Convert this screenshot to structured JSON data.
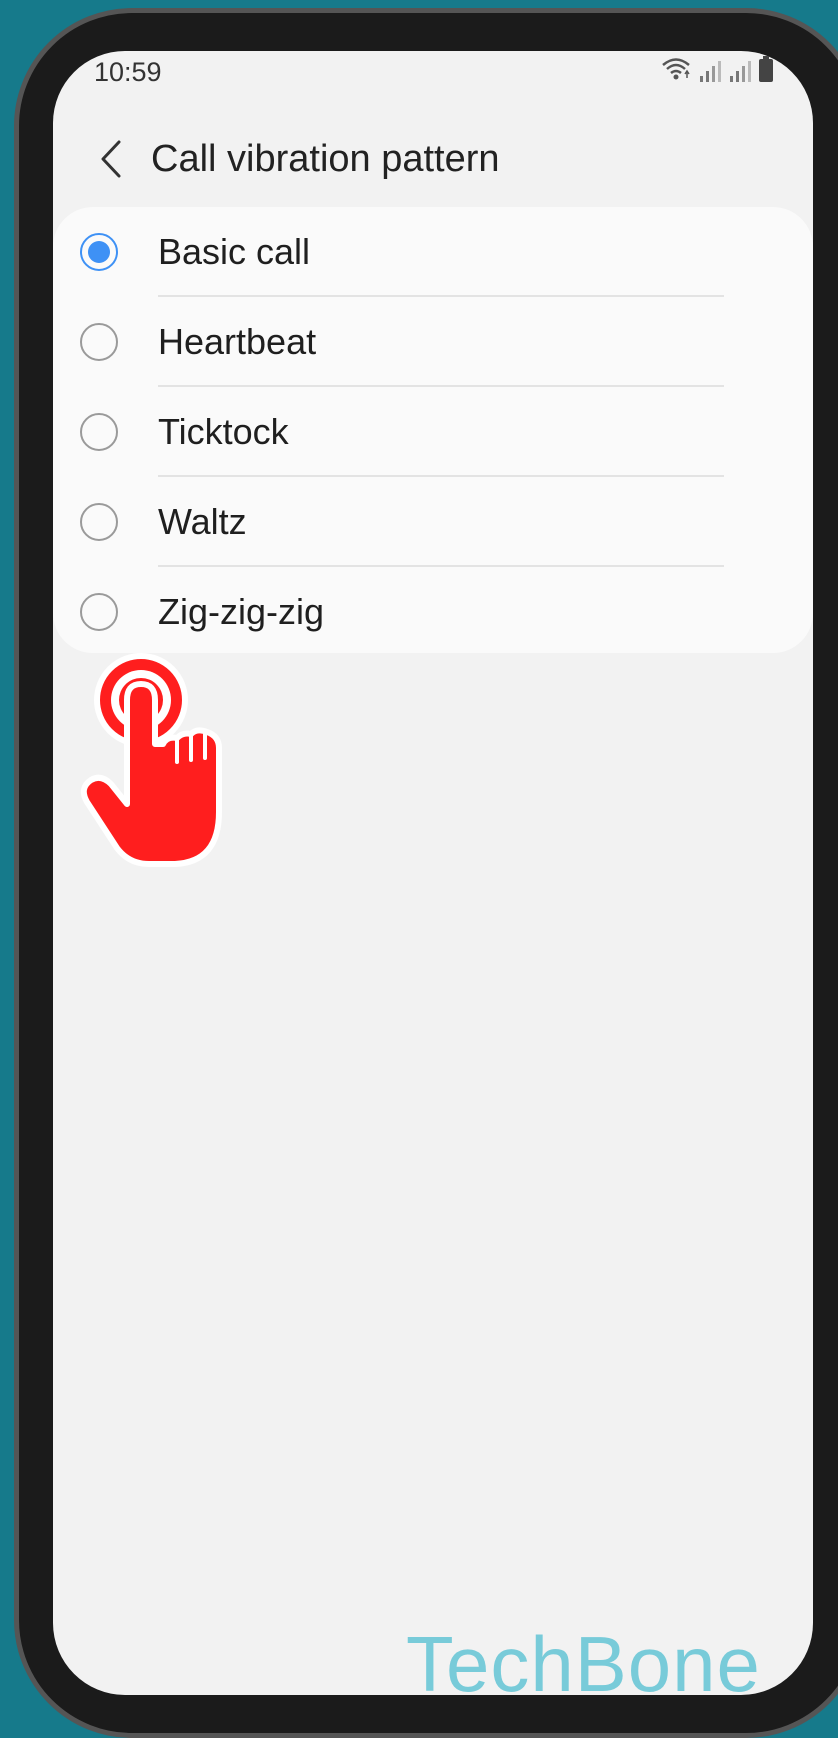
{
  "status_bar": {
    "time": "10:59"
  },
  "header": {
    "title": "Call vibration pattern"
  },
  "options": [
    {
      "label": "Basic call",
      "selected": true
    },
    {
      "label": "Heartbeat",
      "selected": false
    },
    {
      "label": "Ticktock",
      "selected": false
    },
    {
      "label": "Waltz",
      "selected": false
    },
    {
      "label": "Zig-zig-zig",
      "selected": false
    }
  ],
  "watermark": "TechBone",
  "colors": {
    "background": "#167a8b",
    "accent": "#3e91f5",
    "tap_indicator": "#ff1e1e",
    "watermark": "#78cbd9"
  },
  "icons": {
    "back": "back-chevron-icon",
    "wifi": "wifi-icon",
    "signal": "signal-icon",
    "battery": "battery-icon",
    "tap": "tap-hand-icon"
  }
}
